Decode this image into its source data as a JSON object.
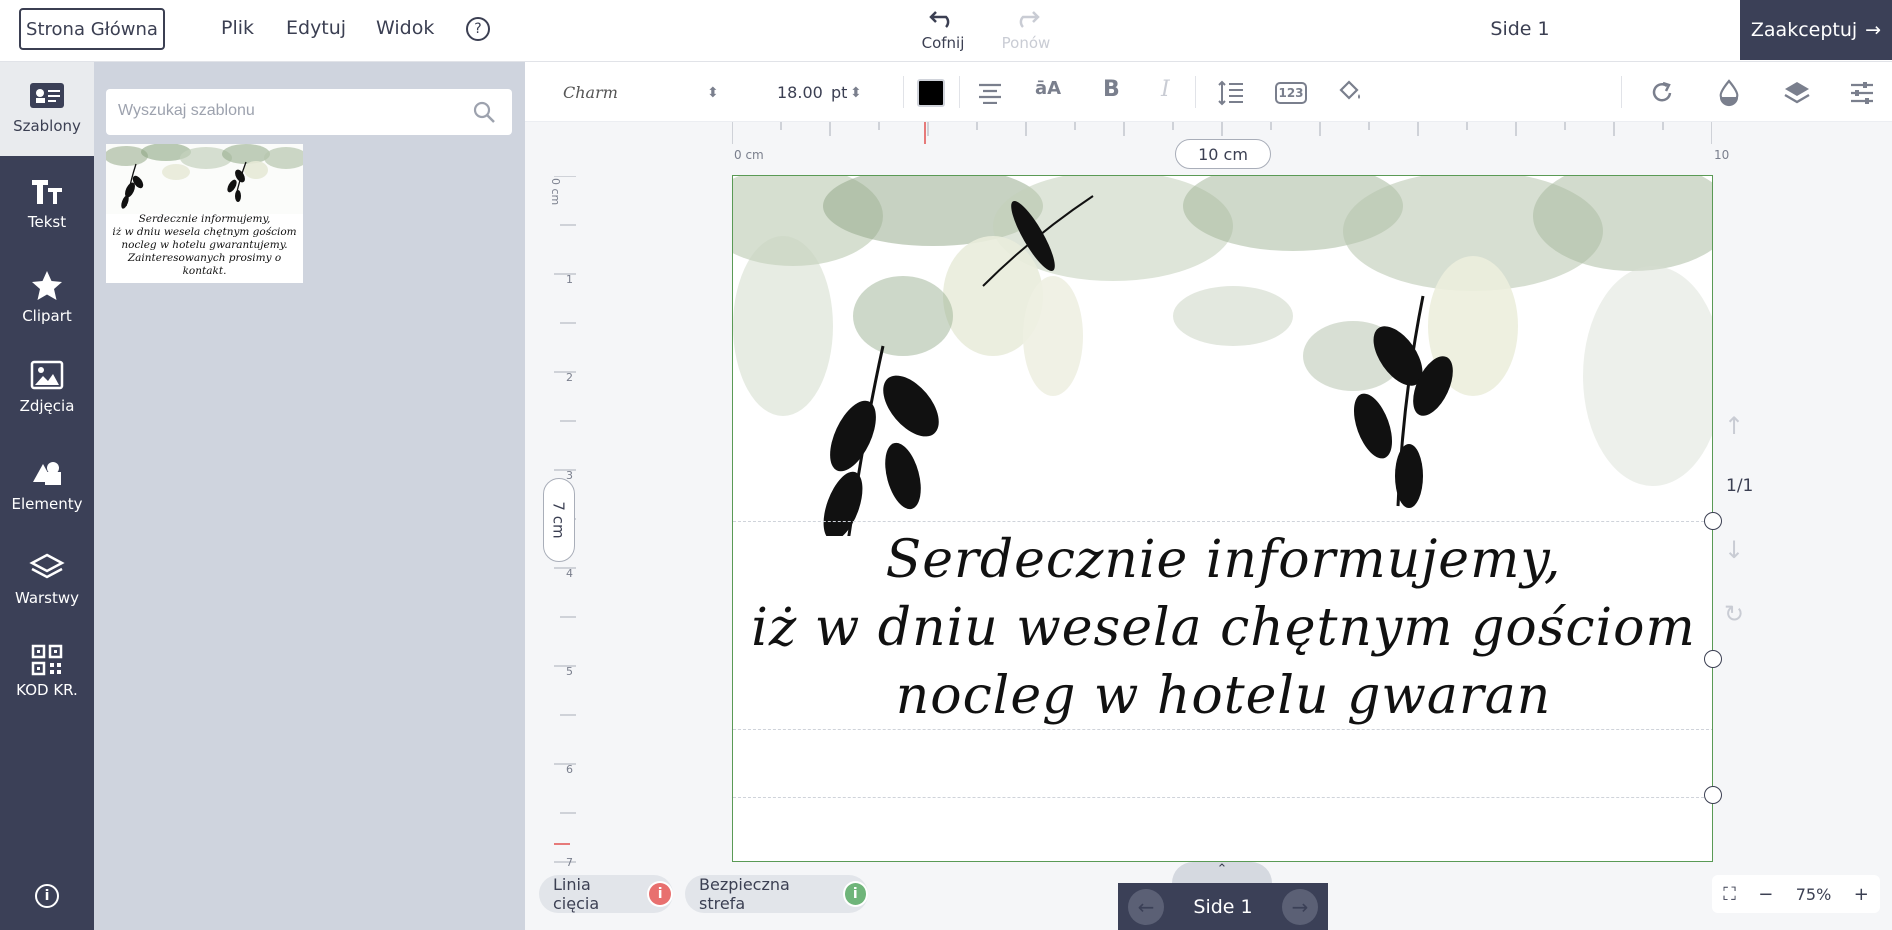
{
  "header": {
    "home_label": "Strona Główna",
    "menu": [
      "Plik",
      "Edytuj",
      "Widok"
    ],
    "help": "?",
    "undo_label": "Cofnij",
    "redo_label": "Ponów",
    "side_title": "Side 1",
    "accept_label": "Zaakceptuj"
  },
  "sidebar": {
    "items": [
      {
        "label": "Szablony",
        "icon": "id-card-icon"
      },
      {
        "label": "Tekst",
        "icon": "text-icon"
      },
      {
        "label": "Clipart",
        "icon": "star-icon"
      },
      {
        "label": "Zdjęcia",
        "icon": "image-icon"
      },
      {
        "label": "Elementy",
        "icon": "shapes-icon"
      },
      {
        "label": "Warstwy",
        "icon": "layers-icon"
      },
      {
        "label": "KOD KR.",
        "icon": "qr-code-icon"
      }
    ],
    "info": "i"
  },
  "templates": {
    "search_placeholder": "Wyszukaj szablonu",
    "thumb_lines": [
      "Serdecznie informujemy,",
      "iż w dniu wesela chętnym gościom",
      "nocleg w hotelu gwarantujemy.",
      "Zainteresowanych prosimy o kontakt."
    ]
  },
  "toolbar": {
    "font_name": "Charm",
    "font_size": "18.00",
    "font_unit": "pt",
    "color": "#000000"
  },
  "rulers": {
    "top_start": "0 cm",
    "top_end": "10",
    "width_label": "10 cm",
    "height_label": "7 cm",
    "left_labels": [
      "0 cm",
      "1",
      "2",
      "3",
      "4",
      "5",
      "6",
      "7"
    ]
  },
  "canvas": {
    "text_lines": [
      "Serdecznie informujemy,",
      "iż w dniu wesela chętnym gościom",
      "nocleg w hotelu gwaran"
    ],
    "page_count": "1/1"
  },
  "footer": {
    "cut_line_label": "Linia cięcia",
    "safe_zone_label": "Bezpieczna strefa",
    "cut_color": "#e8706f",
    "safe_color": "#6fb57a",
    "side_label": "Side 1",
    "zoom": "75%"
  }
}
